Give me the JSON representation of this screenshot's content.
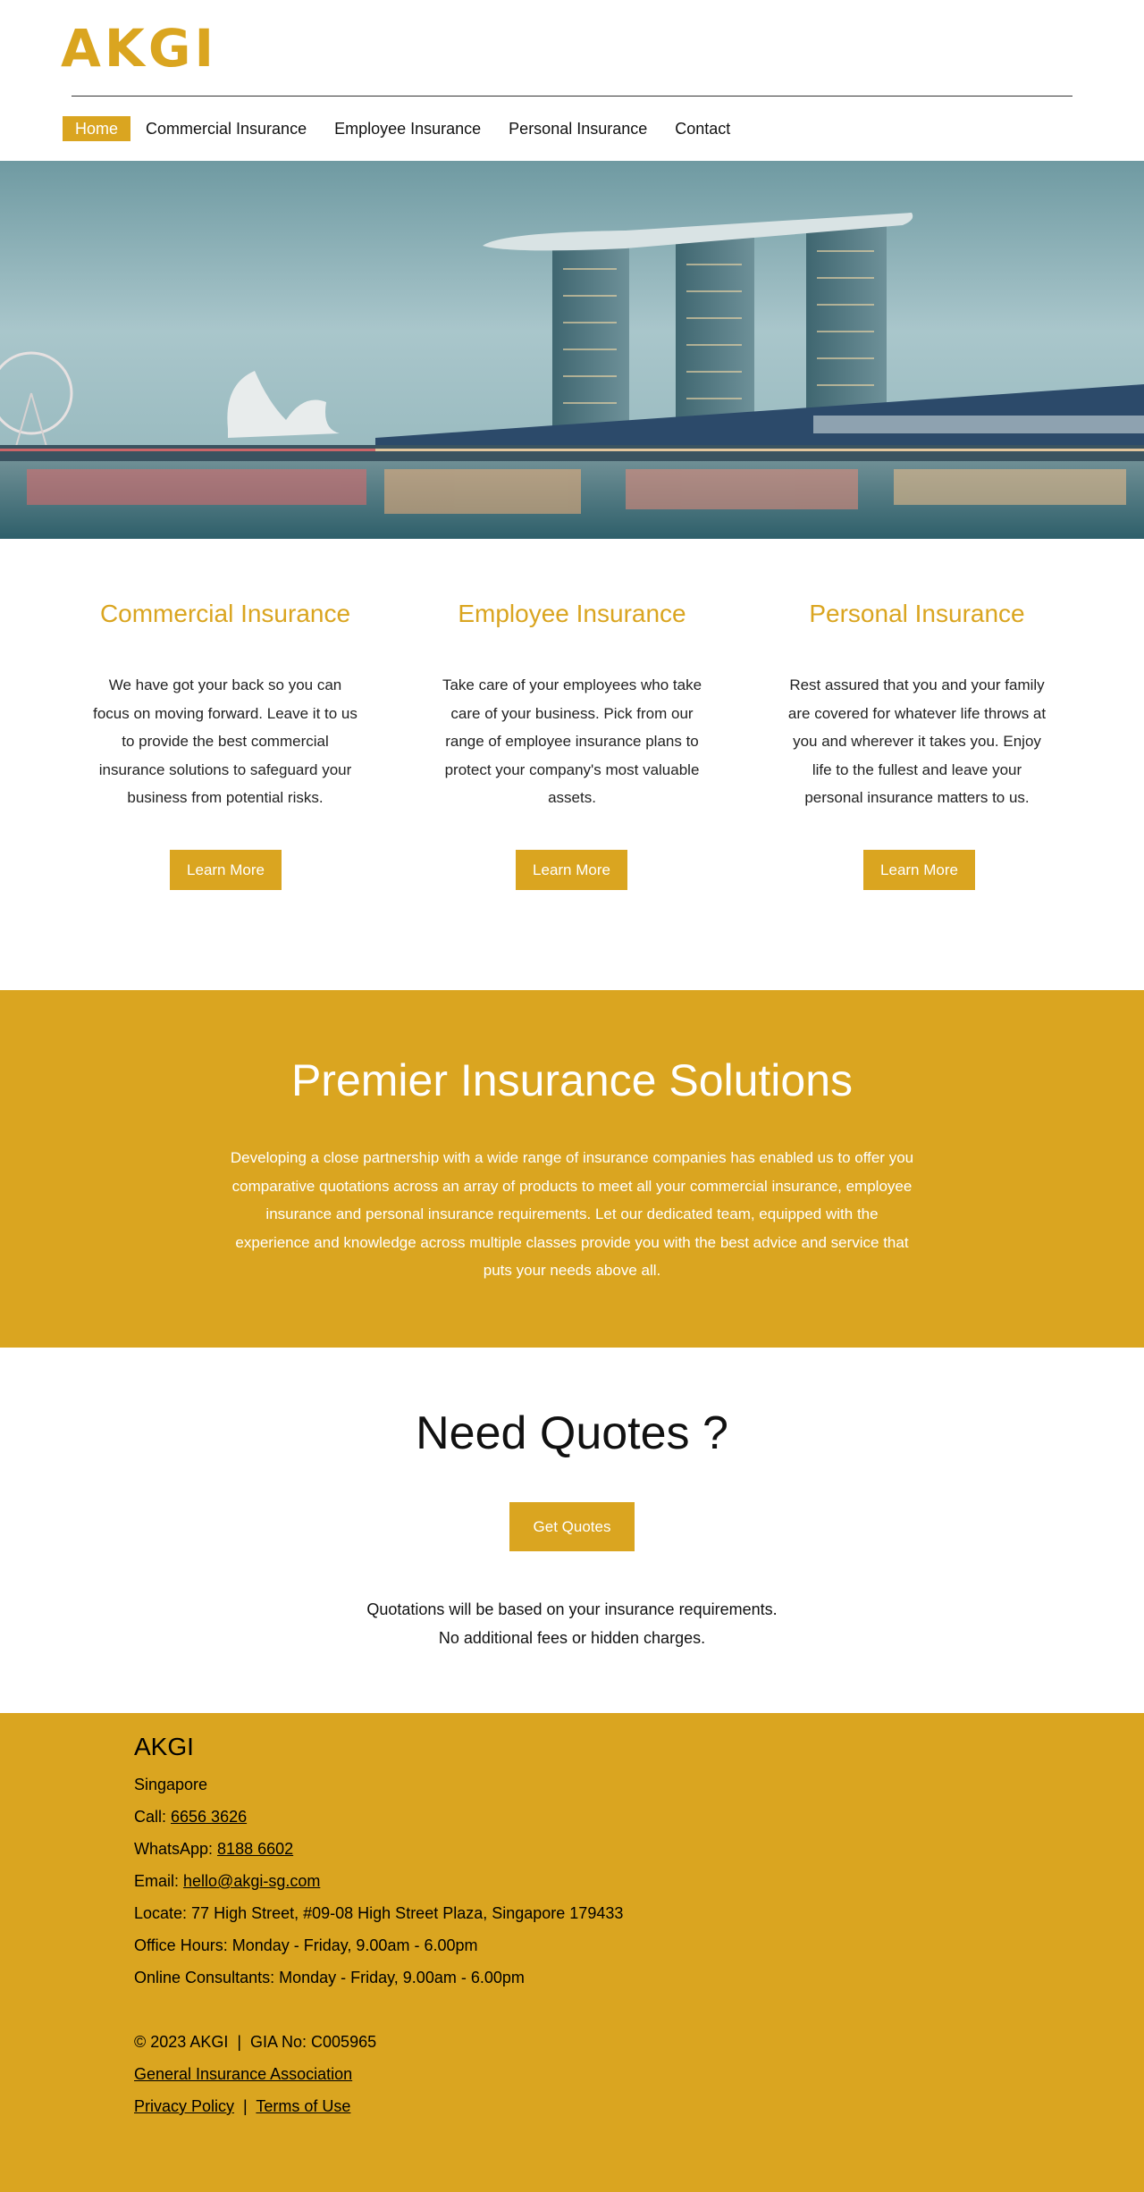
{
  "brand": {
    "logo_text": "AKGI",
    "accent_color": "#daa520"
  },
  "nav": {
    "items": [
      {
        "label": "Home",
        "active": true
      },
      {
        "label": "Commercial Insurance",
        "active": false
      },
      {
        "label": "Employee Insurance",
        "active": false
      },
      {
        "label": "Personal Insurance",
        "active": false
      },
      {
        "label": "Contact",
        "active": false
      }
    ]
  },
  "hero": {
    "image": "Marina Bay Sands skyline at dusk with harbour reflections"
  },
  "services": [
    {
      "title": "Commercial Insurance",
      "text": "We have got your back so you can focus on moving forward. Leave it to us to provide the best commercial insurance solutions to safeguard your business from potential risks.",
      "button": "Learn More"
    },
    {
      "title": "Employee Insurance",
      "text": "Take care of your employees who take care of your business. Pick from our range of employee insurance plans to protect your company's most valuable assets.",
      "button": "Learn More"
    },
    {
      "title": "Personal Insurance",
      "text": "Rest assured that you and your family are covered for whatever life throws at you and wherever it takes you. Enjoy life to the fullest and leave your personal insurance matters to us.",
      "button": "Learn More"
    }
  ],
  "premier": {
    "title": "Premier Insurance Solutions",
    "text": "Developing a close partnership with a wide range of insurance companies has enabled us to offer you comparative quotations across an array of products to meet all your commercial insurance, employee insurance and personal insurance requirements. Let our dedicated team, equipped with the experience and knowledge across multiple classes provide you with the best advice and service that puts your needs above all."
  },
  "quotes": {
    "title": "Need Quotes ?",
    "button": "Get Quotes",
    "note_line1": "Quotations will be based on your insurance requirements.",
    "note_line2": "No additional fees or hidden charges."
  },
  "footer": {
    "brand": "AKGI",
    "location": "Singapore",
    "call_label": "Call: ",
    "call_number": "6656 3626",
    "whatsapp_label": "WhatsApp: ",
    "whatsapp_number": "8188 6602",
    "email_label": "Email: ",
    "email": "hello@akgi-sg.com",
    "address": "Locate: 77 High Street, #09-08 High Street Plaza, Singapore 179433",
    "office_hours": "Office Hours: Monday - Friday, 9.00am - 6.00pm",
    "online_consultants": "Online Consultants: Monday - Friday, 9.00am - 6.00pm",
    "copyright": "© 2023 AKGI  |  GIA No: C005965",
    "gia_link": "General Insurance Association",
    "privacy": "Privacy Policy",
    "separator": "  |  ",
    "terms": "Terms of Use"
  }
}
